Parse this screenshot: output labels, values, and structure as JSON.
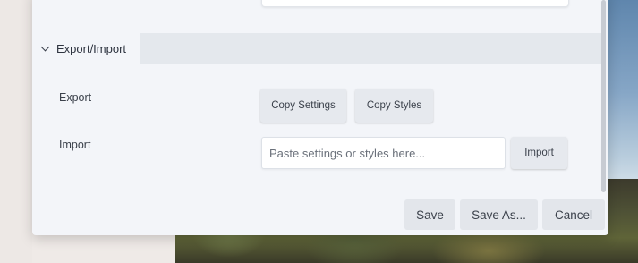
{
  "section": {
    "title": "Export/Import",
    "export_label": "Export",
    "import_label": "Import"
  },
  "export_buttons": {
    "copy_settings": "Copy Settings",
    "copy_styles": "Copy Styles"
  },
  "import": {
    "placeholder": "Paste settings or styles here...",
    "value": "",
    "button": "Import"
  },
  "footer": {
    "save": "Save",
    "save_as": "Save As...",
    "cancel": "Cancel"
  },
  "icons": {
    "section_toggle": "chevron-down-icon"
  }
}
